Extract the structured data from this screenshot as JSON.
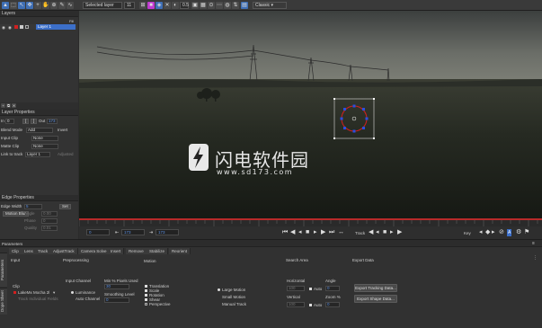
{
  "toolbar": {
    "layer_select": "Selected layer",
    "layer_count": "11",
    "zoom": "0.5",
    "workspace": "Classic"
  },
  "layers_panel": {
    "title": "Layers",
    "fill_label": "Fill",
    "layer_name": "Layer 1"
  },
  "layer_properties": {
    "title": "Layer Properties",
    "in_label": "In",
    "in_value": "0",
    "out_label": "Out",
    "out_value": "173",
    "in_btn": "[",
    "out_btn": "]",
    "blend_mode_label": "Blend Mode",
    "blend_mode_value": "Add",
    "invert_label": "Invert",
    "input_clip_label": "Input Clip",
    "input_clip_value": "None",
    "matte_clip_label": "Matte Clip",
    "matte_clip_value": "None",
    "link_label": "Link to track",
    "link_value": "Layer 1",
    "link_extra": "Adjusted"
  },
  "edge_properties": {
    "title": "Edge Properties",
    "edge_width_label": "Edge Width",
    "edge_width_value": "5",
    "set_btn": "Set",
    "blur_btn": "Motion Blur",
    "angle_label": "Angle",
    "angle_value": "0.00",
    "phase_label": "Phase",
    "phase_value": "0",
    "quality_label": "Quality",
    "quality_value": "0.01"
  },
  "viewer": {
    "watermark_cn": "闪电软件园",
    "watermark_url": "www.sd173.com"
  },
  "transport": {
    "frame_start": "0",
    "frame_current": "173",
    "frame_end": "173",
    "track_label": "Track",
    "key_label": "Key"
  },
  "parameters": {
    "title": "Parameters",
    "side_tab_params": "Parameters",
    "side_tab_dope": "Dope Sheet",
    "tabs": [
      "Clip",
      "Lens",
      "Track",
      "AdjustTrack",
      "Camera Solve",
      "Insert",
      "Remove",
      "Stabilize",
      "Reorient"
    ],
    "input_header": "Input",
    "preprocessing_header": "Preprocessing",
    "motion_header": "Motion",
    "search_area_header": "Search Area",
    "export_header": "Export Data",
    "clip_label": "Clip",
    "clip_value": "LakeMx Mocha 2l",
    "track_individual": "Track Individual Fields",
    "input_channel_label": "Input Channel",
    "luminance": "Luminance",
    "auto_channel": "Auto Channel",
    "min_pixels_label": "Min % Pixels Used",
    "min_pixels_value": "30",
    "smoothing_label": "Smoothing Level",
    "smoothing_value": "0",
    "translation": "Translation",
    "scale": "Scale",
    "rotation": "Rotation",
    "shear": "Shear",
    "perspective": "Perspective",
    "large_motion": "Large Motion",
    "small_motion": "Small Motion",
    "manual_track": "Manual Track",
    "horizontal_label": "Horizontal",
    "horizontal_value": "100",
    "vertical_label": "Vertical",
    "vertical_value": "100",
    "auto_label": "Auto",
    "angle_label": "Angle",
    "angle_value": "0",
    "zoom_label": "Zoom %",
    "zoom_value": "0",
    "export_tracking_btn": "Export Tracking Data...",
    "export_shape_btn": "Export Shape Data..."
  },
  "colors": {
    "accent": "#3c6fc9",
    "timeline_red": "#b82a2a",
    "spline_red": "#d22020",
    "handle_blue": "#2a4fe0"
  }
}
